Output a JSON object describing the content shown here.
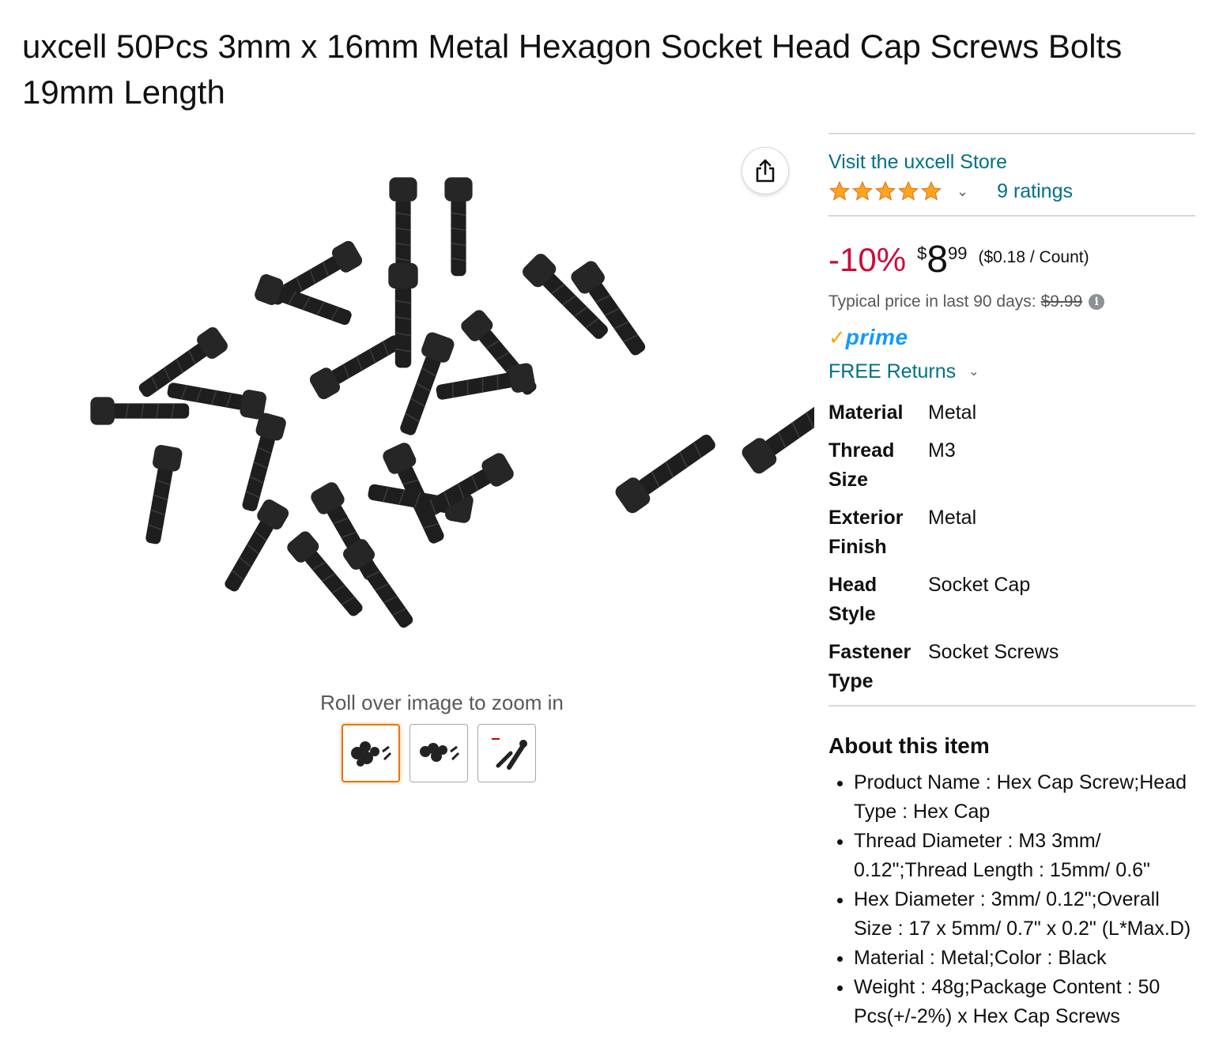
{
  "product": {
    "title": "uxcell 50Pcs 3mm x 16mm Metal Hexagon Socket Head Cap Screws Bolts 19mm Length"
  },
  "gallery": {
    "zoom_hint": "Roll over image to zoom in",
    "thumbnails": [
      "thumbnail-1",
      "thumbnail-2",
      "thumbnail-3"
    ],
    "active_thumbnail": 0
  },
  "store": {
    "link_label": "Visit the uxcell Store",
    "rating_stars": 5,
    "ratings_label": "9 ratings"
  },
  "pricing": {
    "discount": "-10%",
    "currency_symbol": "$",
    "whole": "8",
    "fraction": "99",
    "unit_price": "($0.18 / Count)",
    "typical_label": "Typical price in last 90 days:",
    "typical_price": "$9.99"
  },
  "prime": {
    "label": "prime"
  },
  "returns": {
    "label": "FREE Returns"
  },
  "specs": [
    {
      "key": "Material",
      "value": "Metal"
    },
    {
      "key": "Thread Size",
      "value": "M3"
    },
    {
      "key": "Exterior Finish",
      "value": "Metal"
    },
    {
      "key": "Head Style",
      "value": "Socket Cap"
    },
    {
      "key": "Fastener Type",
      "value": "Socket Screws"
    }
  ],
  "about": {
    "title": "About this item",
    "bullets": [
      "Product Name : Hex Cap Screw;Head Type : Hex Cap",
      "Thread Diameter : M3 3mm/ 0.12\";Thread Length : 15mm/ 0.6\"",
      "Hex Diameter : 3mm/ 0.12\";Overall Size : 17 x 5mm/ 0.7\" x 0.2\" (L*Max.D)",
      "Material : Metal;Color : Black",
      "Weight : 48g;Package Content : 50 Pcs(+/-2%) x Hex Cap Screws"
    ]
  },
  "colors": {
    "link": "#007185",
    "discount": "#cc0c39",
    "star": "#ffa41c",
    "prime_check": "#f7a600",
    "prime_text": "#1399ff",
    "active_thumb_border": "#e77600"
  }
}
